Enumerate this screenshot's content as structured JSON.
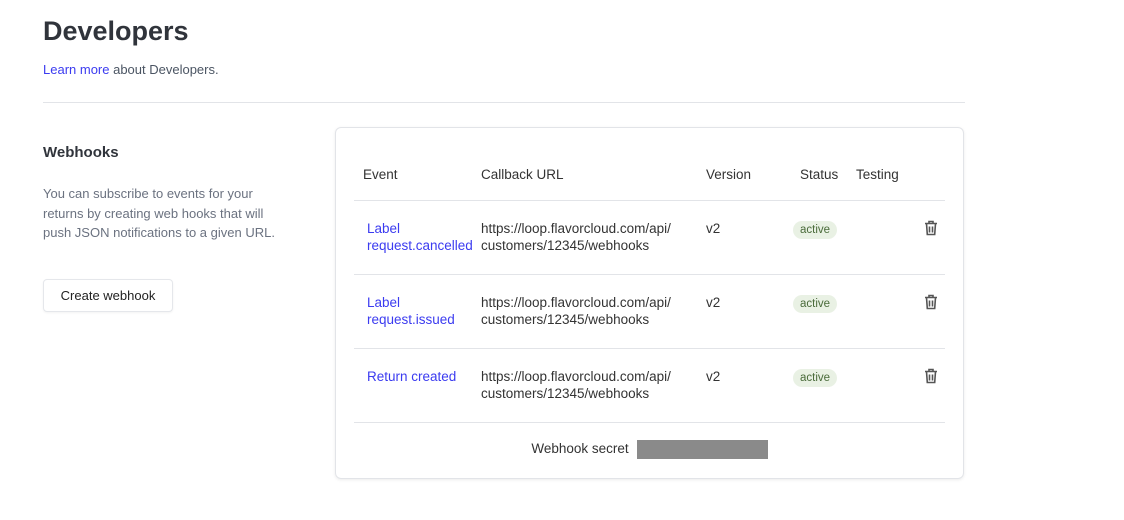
{
  "page": {
    "title": "Developers",
    "learn_more": "Learn more",
    "learn_more_suffix": " about Developers."
  },
  "webhooks": {
    "title": "Webhooks",
    "description": "You can subscribe to events for your returns by creating web hooks that will push JSON notifications to a given URL.",
    "create_button": "Create webhook"
  },
  "table": {
    "headers": [
      "Event",
      "Callback URL",
      "Version",
      "Status",
      "Testing"
    ],
    "rows": [
      {
        "event": "Label request.cancelled",
        "url1": "https://loop.flavorcloud.com/api/",
        "url2": "customers/12345/webhooks",
        "version": "v2",
        "status": "active"
      },
      {
        "event": "Label request.issued",
        "url1": "https://loop.flavorcloud.com/api/",
        "url2": "customers/12345/webhooks",
        "version": "v2",
        "status": "active"
      },
      {
        "event": "Return created",
        "url1": "https://loop.flavorcloud.com/api/",
        "url2": "customers/12345/webhooks",
        "version": "v2",
        "status": "active"
      }
    ],
    "secret_label": "Webhook secret"
  }
}
